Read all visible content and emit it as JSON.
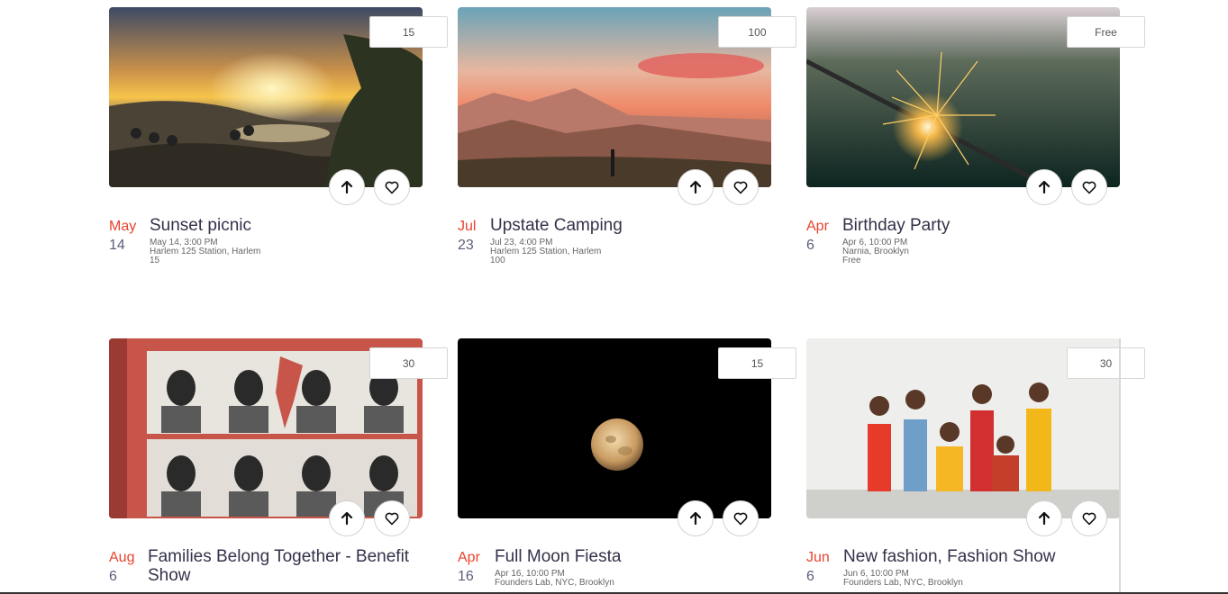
{
  "events": [
    {
      "price": "15",
      "month": "May",
      "day": "14",
      "title": "Sunset picnic",
      "datetime": "May 14, 3:00 PM",
      "location": "Harlem 125 Station, Harlem",
      "cost": "15"
    },
    {
      "price": "100",
      "month": "Jul",
      "day": "23",
      "title": "Upstate Camping",
      "datetime": "Jul 23, 4:00 PM",
      "location": "Harlem 125 Station, Harlem",
      "cost": "100"
    },
    {
      "price": "Free",
      "month": "Apr",
      "day": "6",
      "title": "Birthday Party",
      "datetime": "Apr 6, 10:00 PM",
      "location": "Narnia, Brooklyn",
      "cost": "Free"
    },
    {
      "price": "30",
      "month": "Aug",
      "day": "6",
      "title": "Families Belong Together - Benefit Show",
      "datetime": "",
      "location": "",
      "cost": ""
    },
    {
      "price": "15",
      "month": "Apr",
      "day": "16",
      "title": "Full Moon Fiesta",
      "datetime": "Apr 16, 10:00 PM",
      "location": "Founders Lab, NYC, Brooklyn",
      "cost": ""
    },
    {
      "price": "30",
      "month": "Jun",
      "day": "6",
      "title": "New fashion, Fashion Show",
      "datetime": "Jun 6, 10:00 PM",
      "location": "Founders Lab, NYC, Brooklyn",
      "cost": ""
    }
  ],
  "icons": {
    "upvote": "arrow-up-icon",
    "favorite": "heart-icon"
  },
  "colors": {
    "month": "#e8432e",
    "day": "#5a5f7a",
    "title": "#33324a"
  }
}
